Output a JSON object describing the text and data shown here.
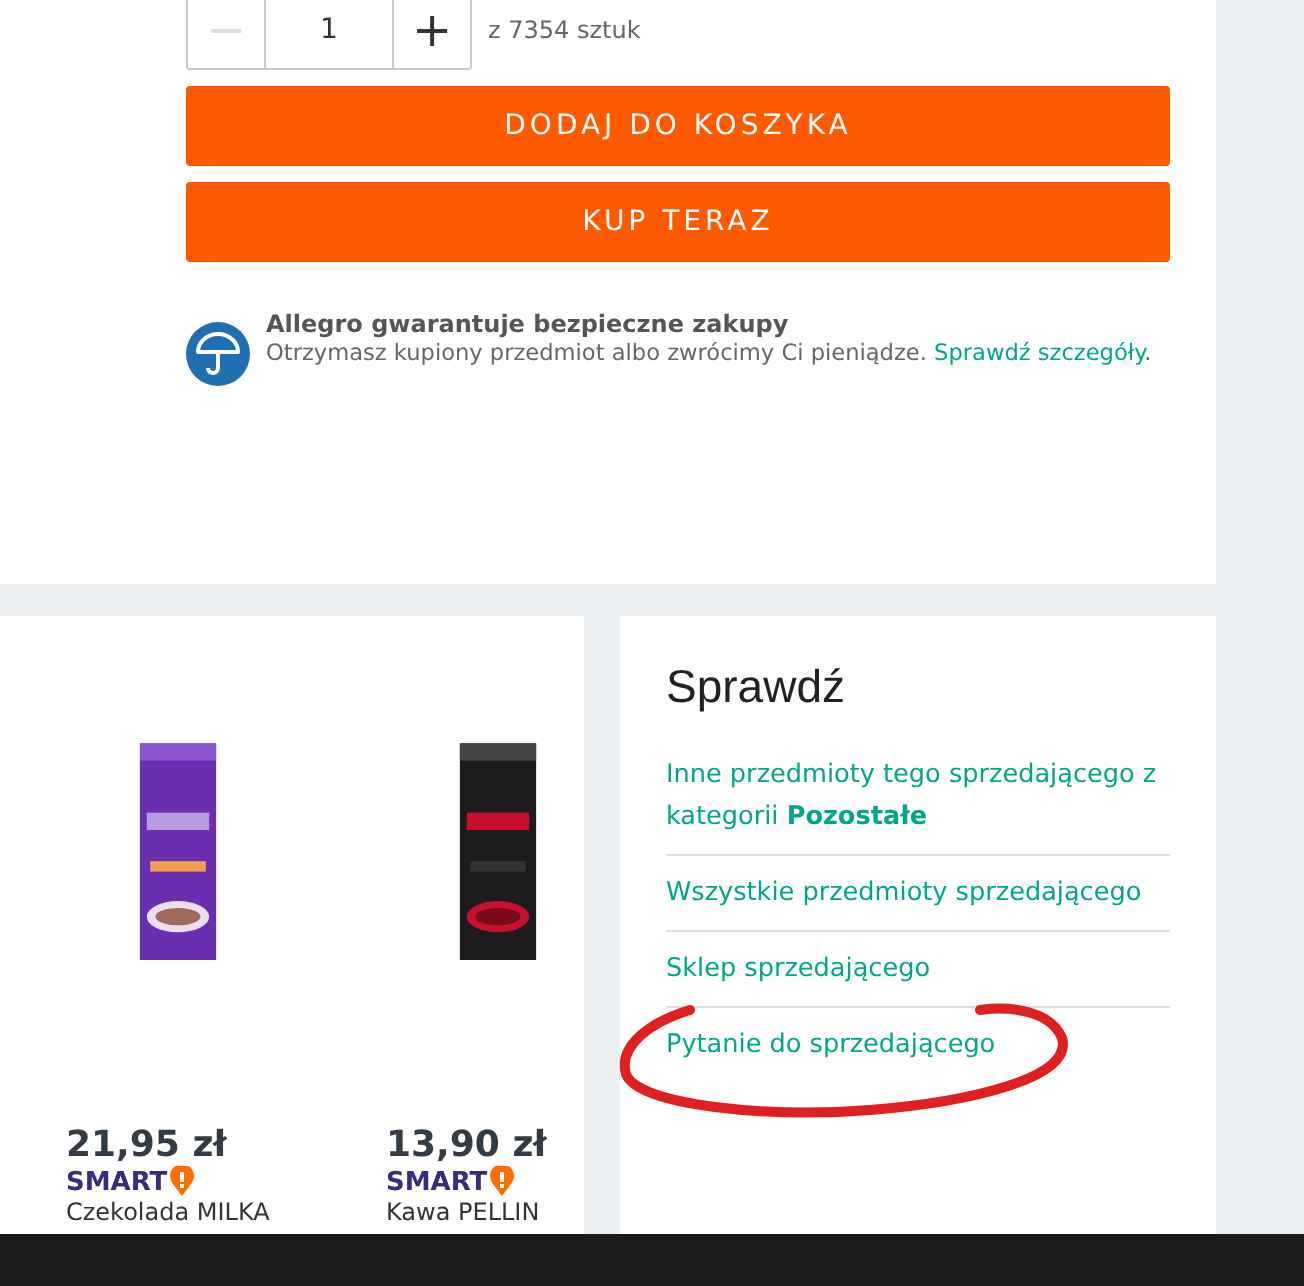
{
  "quantity": {
    "value": "1",
    "minus": "−",
    "plus": "+",
    "minus_disabled": true,
    "available": "z 7354 sztuk"
  },
  "buttons": [
    "DODAJ DO KOSZYKA",
    "KUP TERAZ"
  ],
  "guarantee": {
    "title": "Allegro gwarantuje bezpieczne zakupy",
    "text": "Otrzymasz kupiony przedmiot albo zwrócimy Ci pieniądze.",
    "link": "Sprawdź szczegóły",
    "after": "."
  },
  "products": [
    {
      "kind": "picture",
      "price": "21,95 zł",
      "badge": "SMART",
      "name": "Czekolada MILKA"
    },
    {
      "kind": "picture",
      "price": "13,90 zł",
      "badge": "SMART",
      "name": "Kawa PELLIN"
    }
  ],
  "check": {
    "title": "Sprawdź",
    "links": [
      {
        "text": "Inne przedmioty tego sprzedającego z kategorii **Pozostałe**"
      },
      {
        "text": "Wszystkie przedmioty sprzedającego"
      },
      {
        "text": "Sklep sprzedającego"
      },
      {
        "text": "Pytanie do sprzedającego",
        "circled": true
      }
    ]
  }
}
